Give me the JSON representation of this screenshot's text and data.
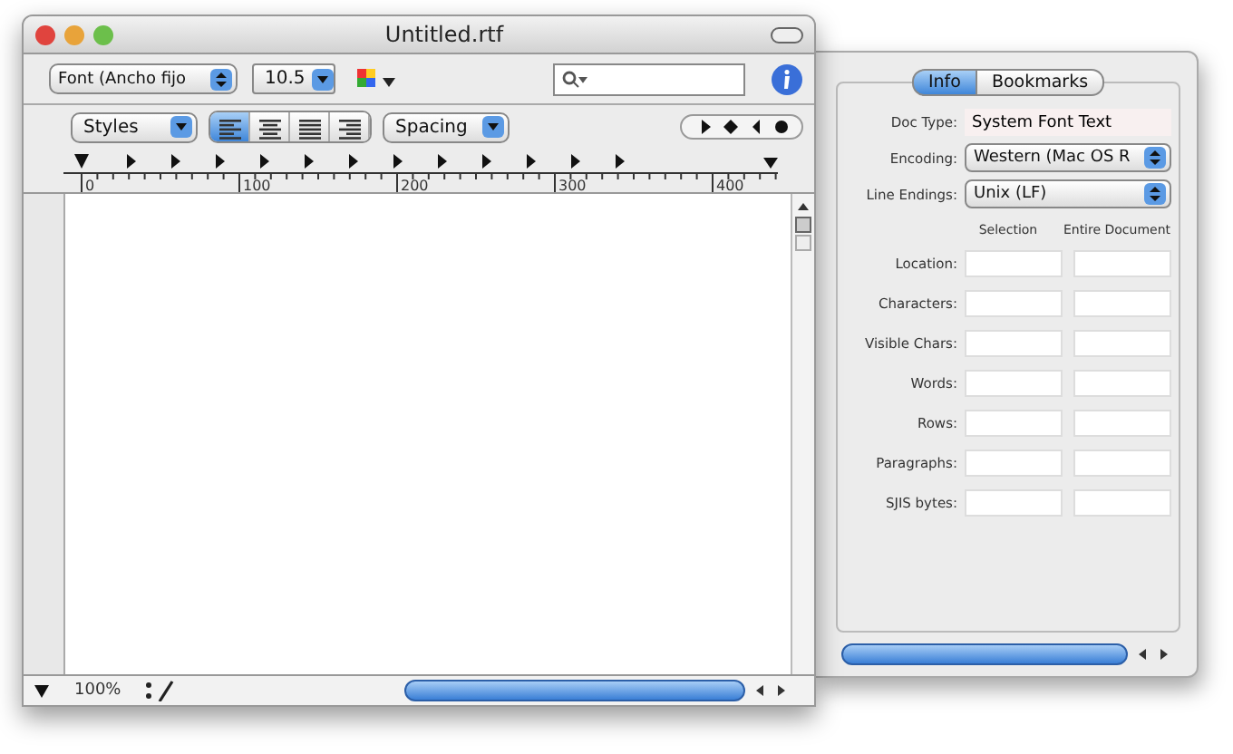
{
  "window": {
    "title": "Untitled.rtf"
  },
  "toolbar": {
    "font": "Font (Ancho fijo",
    "size": "10.5"
  },
  "format_bar": {
    "styles": "Styles",
    "alignments": [
      {
        "kind": "left",
        "selected": true
      },
      {
        "kind": "center",
        "selected": false
      },
      {
        "kind": "justify",
        "selected": false
      },
      {
        "kind": "right",
        "selected": false
      }
    ],
    "spacing": "Spacing"
  },
  "ruler": {
    "labels": [
      "0",
      "100",
      "200",
      "300",
      "400"
    ]
  },
  "status_bar": {
    "zoom": "100%"
  },
  "inspector": {
    "tabs": [
      {
        "label": "Info",
        "selected": true
      },
      {
        "label": "Bookmarks",
        "selected": false
      }
    ],
    "doc_type": {
      "label": "Doc Type:",
      "value": "System Font Text"
    },
    "encoding": {
      "label": "Encoding:",
      "value": "Western (Mac OS R"
    },
    "line_endings": {
      "label": "Line Endings:",
      "value": "Unix (LF)"
    },
    "columns": [
      "Selection",
      "Entire Document"
    ],
    "rows": [
      "Location:",
      "Characters:",
      "Visible Chars:",
      "Words:",
      "Rows:",
      "Paragraphs:",
      "SJIS bytes:"
    ]
  }
}
